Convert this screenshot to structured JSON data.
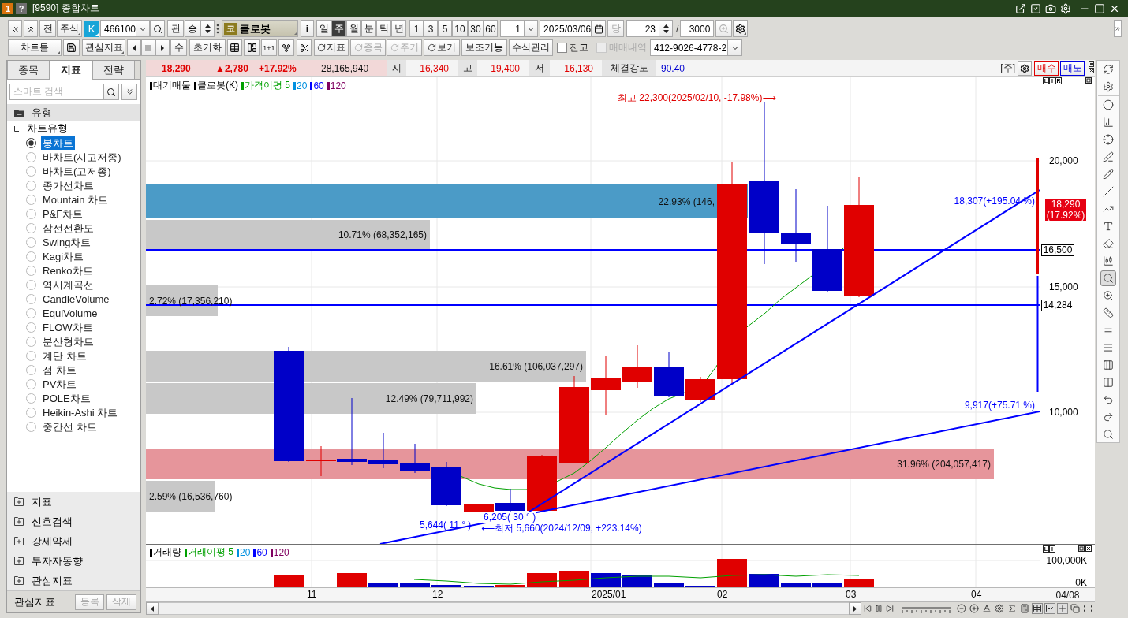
{
  "window": {
    "title": "[9590] 종합차트",
    "badges": [
      {
        "text": "1",
        "color": "#d9730d"
      },
      {
        "text": "?",
        "color": "#6f6f6f"
      }
    ]
  },
  "toolbar": {
    "prev_label": "전",
    "market": "주식",
    "code_badge": "K",
    "code": "466100",
    "watch_label": "관",
    "sort_label": "승",
    "stock_badge": "코",
    "stock_name": "클로봇",
    "info_label": "i",
    "periods": [
      {
        "label": "일",
        "selected": false
      },
      {
        "label": "주",
        "selected": true
      },
      {
        "label": "월",
        "selected": false
      },
      {
        "label": "분",
        "selected": false
      },
      {
        "label": "틱",
        "selected": false
      },
      {
        "label": "년",
        "selected": false
      }
    ],
    "units": [
      "1",
      "3",
      "5",
      "10",
      "30",
      "60"
    ],
    "unit_value": "1",
    "date": "2025/03/06",
    "today": {
      "label": "당",
      "disabled": true
    },
    "count": "23",
    "count_separator": "/",
    "total": "3000",
    "zoom_button": {
      "disabled": true
    }
  },
  "toolbar2": {
    "layout_label": "차트틀",
    "favorites_label": "관심지표",
    "playback": [
      {
        "disabled": false
      },
      {
        "disabled": true
      },
      {
        "disabled": false
      }
    ],
    "count_label": "수",
    "reset_label": "초기화",
    "split_label": "1+1",
    "refresh_buttons": [
      {
        "label": "지표",
        "disabled": false
      },
      {
        "label": "종목",
        "disabled": true
      },
      {
        "label": "주기",
        "disabled": true
      },
      {
        "label": "보기",
        "disabled": false
      }
    ],
    "aux_label": "보조기능",
    "formula_label": "수식관리",
    "checks": [
      {
        "label": "잔고",
        "checked": false,
        "disabled": false
      },
      {
        "label": "매매내역",
        "checked": false,
        "disabled": true
      }
    ],
    "account": "412-9026-4778-2"
  },
  "sidebar": {
    "tabs": [
      {
        "label": "종목",
        "selected": false
      },
      {
        "label": "지표",
        "selected": true
      },
      {
        "label": "전략",
        "selected": false
      }
    ],
    "search": {
      "placeholder": "스마트 검색"
    },
    "tree": [
      {
        "label": "유형",
        "expanded": true,
        "children": [
          {
            "label": "차트유형",
            "children": [
              {
                "label": "봉차트",
                "selected": true
              },
              {
                "label": "바차트(시고저종)",
                "selected": false
              },
              {
                "label": "바차트(고저종)",
                "selected": false
              },
              {
                "label": "종가선차트",
                "selected": false
              },
              {
                "label": "Mountain 차트",
                "selected": false
              },
              {
                "label": "P&F차트",
                "selected": false
              },
              {
                "label": "삼선전환도",
                "selected": false
              },
              {
                "label": "Swing차트",
                "selected": false
              },
              {
                "label": "Kagi차트",
                "selected": false
              },
              {
                "label": "Renko차트",
                "selected": false
              },
              {
                "label": "역시계곡선",
                "selected": false
              },
              {
                "label": "CandleVolume",
                "selected": false
              },
              {
                "label": "EquiVolume",
                "selected": false
              },
              {
                "label": "FLOW차트",
                "selected": false
              },
              {
                "label": "분산형차트",
                "selected": false
              },
              {
                "label": "계단 차트",
                "selected": false
              },
              {
                "label": "점 차트",
                "selected": false
              },
              {
                "label": "PV차트",
                "selected": false
              },
              {
                "label": "POLE차트",
                "selected": false
              },
              {
                "label": "Heikin-Ashi 차트",
                "selected": false
              },
              {
                "label": "중간선 차트",
                "selected": false
              }
            ]
          }
        ]
      },
      {
        "label": "지표",
        "expanded": false
      },
      {
        "label": "신호검색",
        "expanded": false
      },
      {
        "label": "강세약세",
        "expanded": false
      },
      {
        "label": "투자자동향",
        "expanded": false
      },
      {
        "label": "관심지표",
        "expanded": false
      }
    ],
    "footer": {
      "label": "관심지표",
      "buttons": [
        {
          "label": "등록",
          "disabled": true
        },
        {
          "label": "삭제",
          "disabled": true
        }
      ]
    }
  },
  "quote": {
    "price": "18,290",
    "change": "▲2,780",
    "rate": "+17.92%",
    "volume": "28,165,940",
    "fields": [
      {
        "label": "시",
        "value": "16,340",
        "color": "#e00000"
      },
      {
        "label": "고",
        "value": "19,400",
        "color": "#e00000"
      },
      {
        "label": "저",
        "value": "16,130",
        "color": "#e00000"
      },
      {
        "label": "체결강도",
        "value": "90.40",
        "color": "#0000d0"
      }
    ],
    "market_tag": "[주]",
    "buy_label": "매수",
    "sell_label": "매도"
  },
  "price_chart": {
    "legend": [
      {
        "label": "대기매물",
        "color": "#000000"
      },
      {
        "label": "클로봇(K)",
        "color": "#000000"
      },
      {
        "label": "가격이평 5",
        "color": "#00a000"
      },
      {
        "label": "20",
        "color": "#0090e0"
      },
      {
        "label": "60",
        "color": "#0000ff"
      },
      {
        "label": "120",
        "color": "#800060"
      }
    ],
    "scale_buttons": [
      "L",
      "I",
      "R"
    ],
    "volume_profile": [
      {
        "label": "22.93% (146,",
        "color": "#4b9bc7"
      },
      {
        "label": "10.71% (68,352,165)",
        "color": "#c8c8c8"
      },
      {
        "label": "2.72% (17,356,210)",
        "color": "#c8c8c8"
      },
      {
        "label": "16.61% (106,037,297)",
        "color": "#c8c8c8"
      },
      {
        "label": "12.49% (79,711,992)",
        "color": "#c8c8c8"
      },
      {
        "label": "31.96% (204,057,417)",
        "color": "#e6959b"
      },
      {
        "label": "2.59% (16,536,760)",
        "color": "#c8c8c8"
      }
    ],
    "annotations": [
      {
        "text": "최고 22,300(2025/02/10, -17.98%)⟶",
        "color": "#e00000"
      },
      {
        "text": "18,307(+195.04 %)",
        "color": "#0000ff"
      },
      {
        "text": "9,917(+75.71 %)",
        "color": "#0000ff"
      },
      {
        "text": "6,205( 30 ° )",
        "color": "#0000ff"
      },
      {
        "text": "5,644( 11 ° )",
        "color": "#0000ff"
      },
      {
        "text": "⟵최저 5,660(2024/12/09, +223.14%)",
        "color": "#0000ff"
      }
    ],
    "axis_labels": [
      "20,000",
      "15,000",
      "10,000"
    ],
    "price_tags": [
      {
        "kind": "current",
        "lines": [
          "18,290",
          "(17.92%)"
        ]
      },
      {
        "kind": "level",
        "lines": [
          "16,500"
        ]
      },
      {
        "kind": "level",
        "lines": [
          "14,284"
        ]
      }
    ]
  },
  "volume_chart": {
    "legend": [
      {
        "label": "거래량",
        "color": "#000000"
      },
      {
        "label": "거래이평 5",
        "color": "#00a000"
      },
      {
        "label": "20",
        "color": "#0090e0"
      },
      {
        "label": "60",
        "color": "#0000ff"
      },
      {
        "label": "120",
        "color": "#800060"
      }
    ],
    "scale_buttons": [
      "L",
      "I"
    ],
    "axis_labels": [
      "100,000K",
      "0K"
    ]
  },
  "x_axis": {
    "labels": [
      "11",
      "12",
      "2025/01",
      "02",
      "03",
      "04"
    ],
    "cursor_date": "04/08"
  },
  "right_tools": [
    {
      "selected": false
    },
    {
      "selected": false
    },
    {
      "selected": false
    },
    {
      "selected": false
    },
    {
      "selected": false
    },
    {
      "selected": false
    },
    {
      "selected": false
    },
    {
      "selected": false
    },
    {
      "selected": false
    },
    {
      "selected": false
    },
    {
      "selected": false
    },
    {
      "selected": false
    },
    {
      "selected": true
    },
    {
      "selected": false
    },
    {
      "selected": false
    },
    {
      "selected": false
    },
    {
      "selected": false
    },
    {
      "selected": false
    },
    {
      "selected": false
    },
    {
      "selected": false
    },
    {
      "selected": false
    },
    {
      "selected": false
    }
  ],
  "bottom_tools": [
    {
      "selected": false
    },
    {
      "selected": false
    },
    {
      "selected": false
    },
    {
      "selected": false
    },
    {
      "selected": false
    },
    {
      "selected": false
    },
    {
      "selected": true
    },
    {
      "selected": true
    },
    {
      "selected": true
    },
    {
      "selected": false
    },
    {
      "selected": false
    }
  ]
}
